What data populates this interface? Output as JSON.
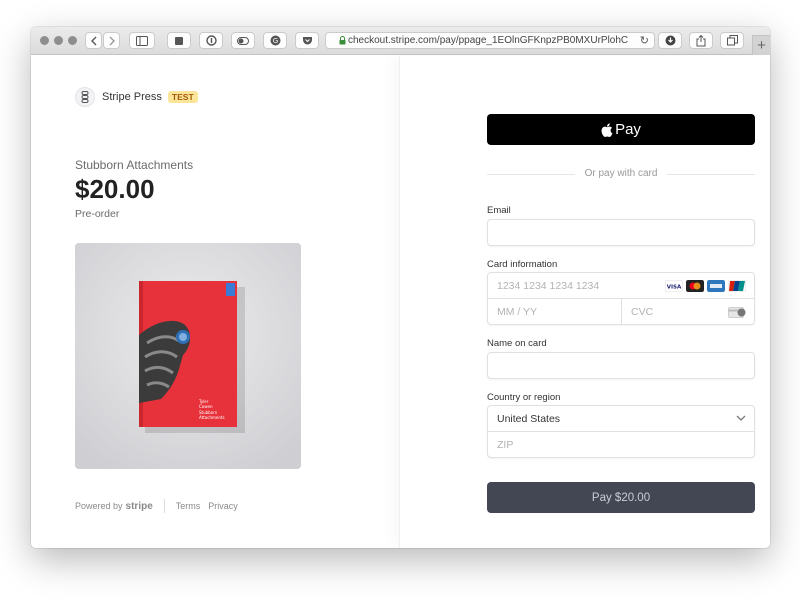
{
  "browser": {
    "url": "checkout.stripe.com/pay/ppage_1EOlnGFKnpzPB0MXUrPlohC",
    "reload_icon": "↻",
    "new_tab_icon": "+"
  },
  "merchant": {
    "name": "Stripe Press",
    "badge": "TEST"
  },
  "product": {
    "title": "Stubborn Attachments",
    "price": "$20.00",
    "status": "Pre-order",
    "cover_lines": [
      "Tyler",
      "Cowen",
      "Stubborn",
      "Attachments"
    ]
  },
  "footer": {
    "powered_by": "Powered by",
    "stripe_word": "stripe",
    "terms": "Terms",
    "privacy": "Privacy"
  },
  "checkout": {
    "apple_pay_label": "Pay",
    "divider_text": "Or pay with card",
    "email_label": "Email",
    "email_value": "",
    "card_label": "Card information",
    "card_number_placeholder": "1234 1234 1234 1234",
    "expiry_placeholder": "MM / YY",
    "cvc_placeholder": "CVC",
    "name_label": "Name on card",
    "name_value": "",
    "country_label": "Country or region",
    "country_selected": "United States",
    "zip_placeholder": "ZIP",
    "pay_button": "Pay $20.00"
  },
  "colors": {
    "apple_pay_bg": "#000000",
    "pay_button_bg": "#434754",
    "badge_bg": "#fbe59a",
    "book_red": "#e8323b"
  }
}
